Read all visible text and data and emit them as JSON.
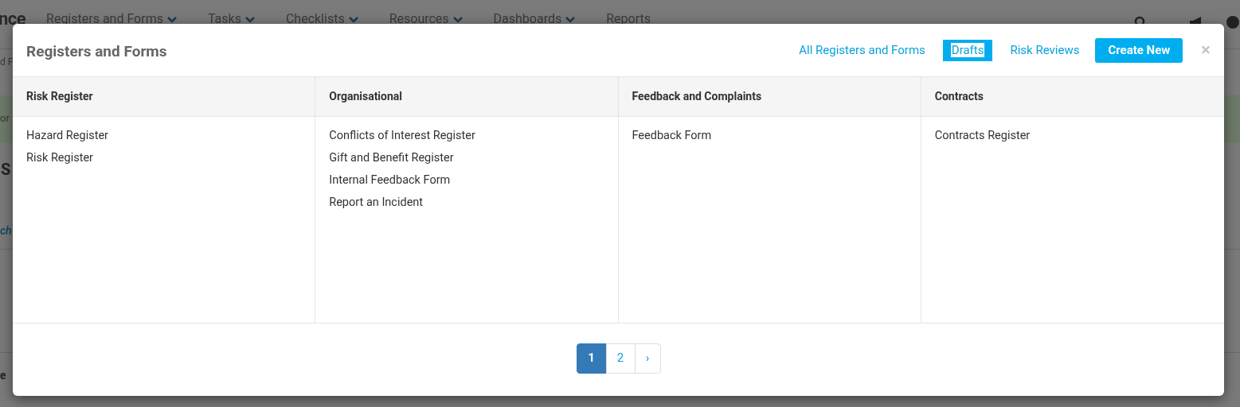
{
  "background": {
    "logo_fragment": "nce",
    "nav": [
      {
        "label": "Registers and Forms",
        "caret": true
      },
      {
        "label": "Tasks",
        "caret": true
      },
      {
        "label": "Checklists",
        "caret": true
      },
      {
        "label": "Resources",
        "caret": true
      },
      {
        "label": "Dashboards",
        "caret": true
      },
      {
        "label": "Reports",
        "caret": false
      }
    ],
    "edge_fragments": [
      "d F",
      "or",
      "S",
      "ch",
      "e"
    ]
  },
  "modal": {
    "title": "Registers and Forms",
    "tabs": [
      {
        "label": "All Registers and Forms",
        "selected": false
      },
      {
        "label": "Drafts",
        "selected": true
      },
      {
        "label": "Risk Reviews",
        "selected": false
      }
    ],
    "create_button": "Create New",
    "close": "×",
    "columns": [
      {
        "heading": "Risk Register",
        "items": [
          "Hazard Register",
          "Risk Register"
        ]
      },
      {
        "heading": "Organisational",
        "items": [
          "Conflicts of Interest Register",
          "Gift and Benefit Register",
          "Internal Feedback Form",
          "Report an Incident"
        ]
      },
      {
        "heading": "Feedback and Complaints",
        "items": [
          "Feedback Form"
        ]
      },
      {
        "heading": "Contracts",
        "items": [
          "Contracts Register"
        ]
      }
    ],
    "pagination": [
      {
        "label": "1",
        "selected": true
      },
      {
        "label": "2",
        "selected": false
      },
      {
        "label": "›",
        "selected": false
      }
    ]
  }
}
